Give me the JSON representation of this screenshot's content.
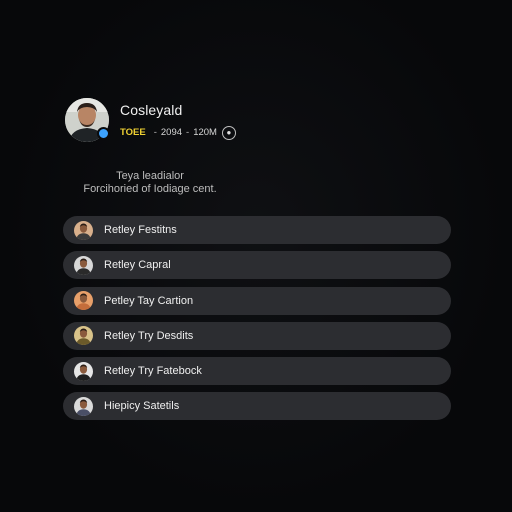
{
  "profile": {
    "name": "Cosleyald",
    "badge": "TOEE",
    "date_range": "2094",
    "time": "120M",
    "status_color": "#3da3ff"
  },
  "bio": {
    "line1": "Teya leadialor",
    "line2": "Forcihoried of Iodiage cent."
  },
  "links": [
    {
      "label": "Retley Festitns",
      "avatar_bg": "#d9b08c",
      "shirt": "#3b3b3b"
    },
    {
      "label": "Retley Capral",
      "avatar_bg": "#d8d8d8",
      "shirt": "#2a2a2a"
    },
    {
      "label": "Petley Tay Cartion",
      "avatar_bg": "#e8a06a",
      "shirt": "#c46d3b"
    },
    {
      "label": "Retley Try Desdits",
      "avatar_bg": "#d9c38a",
      "shirt": "#6b5a2a"
    },
    {
      "label": "Retley Try Fatebock",
      "avatar_bg": "#e6e6e6",
      "shirt": "#1e1e1e"
    },
    {
      "label": "Hiepicy Satetils",
      "avatar_bg": "#dadada",
      "shirt": "#4a4f66"
    }
  ]
}
